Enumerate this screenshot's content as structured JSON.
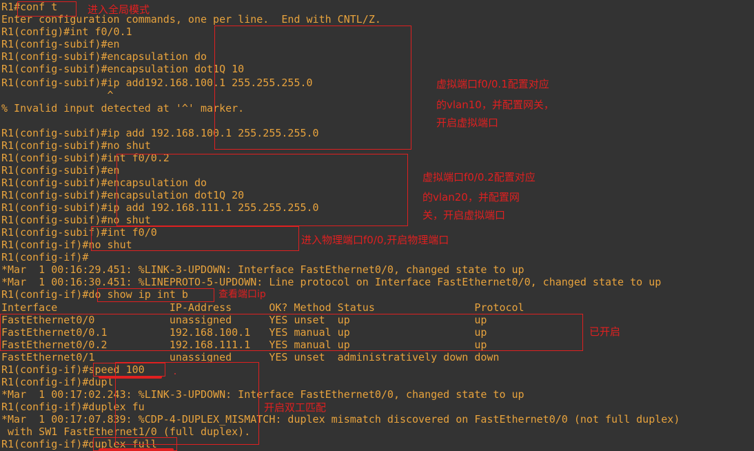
{
  "terminal": {
    "background_color": "#333333",
    "text_color": "#e8a33d",
    "annotation_color": "#e02020",
    "lines": [
      "R1#conf t",
      "Enter configuration commands, one per line.  End with CNTL/Z.",
      "R1(config)#int f0/0.1",
      "R1(config-subif)#en",
      "R1(config-subif)#encapsulation do",
      "R1(config-subif)#encapsulation dot1Q 10",
      "R1(config-subif)#ip add192.168.100.1 255.255.255.0",
      "                 ^",
      "% Invalid input detected at '^' marker.",
      "",
      "R1(config-subif)#ip add 192.168.100.1 255.255.255.0",
      "R1(config-subif)#no shut",
      "R1(config-subif)#int f0/0.2",
      "R1(config-subif)#en",
      "R1(config-subif)#encapsulation do",
      "R1(config-subif)#encapsulation dot1Q 20",
      "R1(config-subif)#ip add 192.168.111.1 255.255.255.0",
      "R1(config-subif)#no shut",
      "R1(config-subif)#int f0/0",
      "R1(config-if)#no shut",
      "R1(config-if)#",
      "*Mar  1 00:16:29.451: %LINK-3-UPDOWN: Interface FastEthernet0/0, changed state to up",
      "*Mar  1 00:16:30.451: %LINEPROTO-5-UPDOWN: Line protocol on Interface FastEthernet0/0, changed state to up",
      "R1(config-if)#do show ip int b",
      "Interface                  IP-Address      OK? Method Status                Protocol",
      "FastEthernet0/0            unassigned      YES unset  up                    up",
      "FastEthernet0/0.1          192.168.100.1   YES manual up                    up",
      "FastEthernet0/0.2          192.168.111.1   YES manual up                    up",
      "FastEthernet0/1            unassigned      YES unset  administratively down down",
      "R1(config-if)#speed 100",
      "R1(config-if)#dupl",
      "*Mar  1 00:17:02.243: %LINK-3-UPDOWN: Interface FastEthernet0/0, changed state to up",
      "R1(config-if)#duplex fu",
      "*Mar  1 00:17:07.839: %CDP-4-DUPLEX_MISMATCH: duplex mismatch discovered on FastEthernet0/0 (not full duplex)",
      " with SW1 FastEthernet1/0 (full duplex).",
      "R1(config-if)#duplex full"
    ]
  },
  "annotations": {
    "enter_global_mode": "进入全局模式",
    "subif1_note_line1": "虚拟端口f0/0.1配置对应",
    "subif1_note_line2": "的vlan10，并配置网关，",
    "subif1_note_line3": "开启虚拟端口",
    "subif2_note_line1": "虚拟端口f0/0.2配置对应",
    "subif2_note_line2": "的vlan20，并配置网",
    "subif2_note_line3": "关，开启虚拟端口",
    "physical_port_note": "进入物理端口f0/0,开启物理端口",
    "show_ip_note": "查看端口ip",
    "already_up_note": "已开启",
    "duplex_note": "开启双工匹配"
  }
}
